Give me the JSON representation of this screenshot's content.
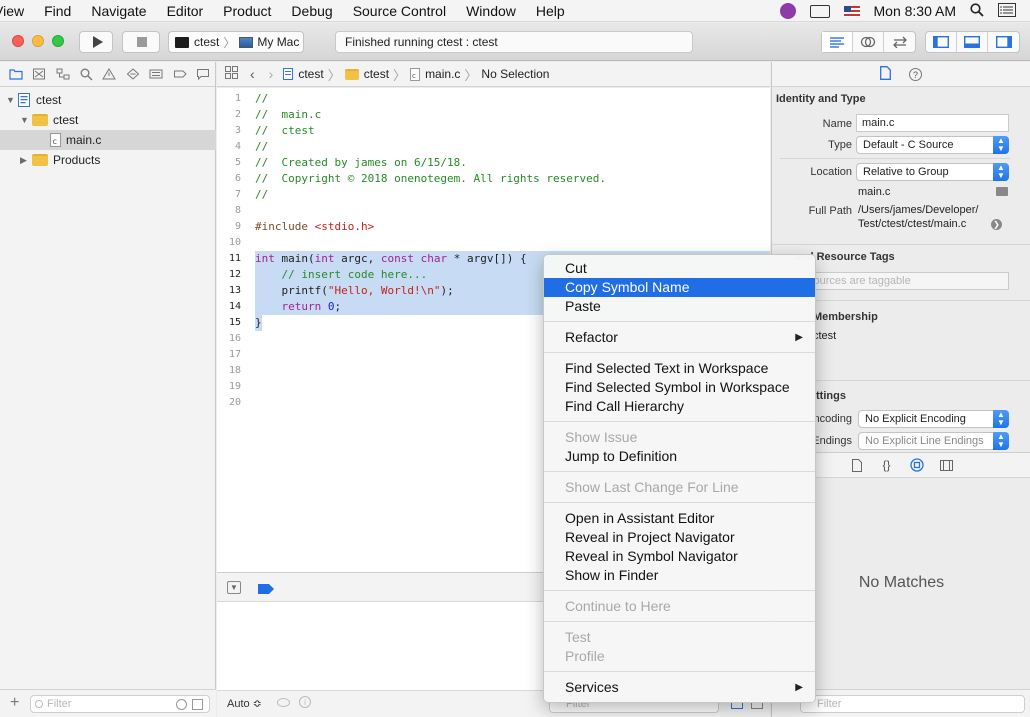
{
  "menubar": {
    "menus": [
      "View",
      "Find",
      "Navigate",
      "Editor",
      "Product",
      "Debug",
      "Source Control",
      "Window",
      "Help"
    ],
    "clock": "Mon 8:30 AM"
  },
  "toolbar": {
    "scheme_target": "ctest",
    "scheme_device": "My Mac",
    "activity": "Finished running ctest : ctest"
  },
  "navigator": {
    "items": [
      {
        "label": "ctest"
      },
      {
        "label": "ctest"
      },
      {
        "label": "main.c"
      },
      {
        "label": "Products"
      }
    ],
    "filter_placeholder": "Filter"
  },
  "jumpbar": {
    "crumbs": [
      "ctest",
      "ctest",
      "main.c",
      "No Selection"
    ]
  },
  "editor": {
    "line_numbers": [
      "1",
      "2",
      "3",
      "4",
      "5",
      "6",
      "7",
      "8",
      "9",
      "10",
      "11",
      "12",
      "13",
      "14",
      "15",
      "16",
      "17",
      "18",
      "19",
      "20"
    ],
    "lines": {
      "l1": "//",
      "l2": "//  main.c",
      "l3": "//  ctest",
      "l4": "//",
      "l5": "//  Created by james on 6/15/18.",
      "l6": "//  Copyright © 2018 onenotegem. All rights reserved.",
      "l7": "//",
      "l9_a": "#include ",
      "l9_b": "<stdio.h>",
      "l11_a": "int",
      "l11_b": " main(",
      "l11_c": "int",
      "l11_d": " argc, ",
      "l11_e": "const",
      "l11_f": " ",
      "l11_g": "char",
      "l11_h": " * argv[]) {",
      "l12": "    // insert code here...",
      "l13_a": "    printf(",
      "l13_b": "\"Hello, World!\\n\"",
      "l13_c": ");",
      "l14_a": "    ",
      "l14_b": "return",
      "l14_c": " ",
      "l14_d": "0",
      "l14_e": ";",
      "l15": "}"
    }
  },
  "debug": {
    "output_mode": "Auto ≎",
    "filter_placeholder": "Filter"
  },
  "inspector": {
    "identity_title": "Identity and Type",
    "name_label": "Name",
    "name_value": "main.c",
    "type_label": "Type",
    "type_value": "Default - C Source",
    "location_label": "Location",
    "location_value": "Relative to Group",
    "location_file": "main.c",
    "full_path_label": "Full Path",
    "full_path_1": "/Users/james/Developer/",
    "full_path_2": "Test/ctest/ctest/main.c",
    "odr_title_part": "and Resource Tags",
    "odr_placeholder_part": "sources are taggable",
    "target_title_part": "Membership",
    "target_item_part": "ctest",
    "text_settings_part": "ttings",
    "encoding_label_part": "ncoding",
    "encoding_value": "No Explicit Encoding",
    "endings_label_part": "Endings",
    "endings_value": "No Explicit Line Endings",
    "no_matches": "No Matches",
    "filter_placeholder": "Filter"
  },
  "context_menu": {
    "items": [
      {
        "label": "Cut",
        "state": "normal"
      },
      {
        "label": "Copy Symbol Name",
        "state": "highlighted"
      },
      {
        "label": "Paste",
        "state": "normal"
      },
      {
        "label": "Refactor",
        "state": "normal",
        "submenu": true
      },
      {
        "label": "Find Selected Text in Workspace",
        "state": "normal"
      },
      {
        "label": "Find Selected Symbol in Workspace",
        "state": "normal"
      },
      {
        "label": "Find Call Hierarchy",
        "state": "normal"
      },
      {
        "label": "Show Issue",
        "state": "disabled"
      },
      {
        "label": "Jump to Definition",
        "state": "normal"
      },
      {
        "label": "Show Last Change For Line",
        "state": "disabled"
      },
      {
        "label": "Open in Assistant Editor",
        "state": "normal"
      },
      {
        "label": "Reveal in Project Navigator",
        "state": "normal"
      },
      {
        "label": "Reveal in Symbol Navigator",
        "state": "normal"
      },
      {
        "label": "Show in Finder",
        "state": "normal"
      },
      {
        "label": "Continue to Here",
        "state": "disabled"
      },
      {
        "label": "Test",
        "state": "disabled"
      },
      {
        "label": "Profile",
        "state": "disabled"
      },
      {
        "label": "Services",
        "state": "normal",
        "submenu": true
      }
    ]
  },
  "colors": {
    "selection_highlight": "#1f6ee6",
    "code_selection": "#c7dcf4",
    "comment": "#268a26",
    "keyword": "#a2238e",
    "string": "#c4221a",
    "number": "#1c1ae0"
  }
}
